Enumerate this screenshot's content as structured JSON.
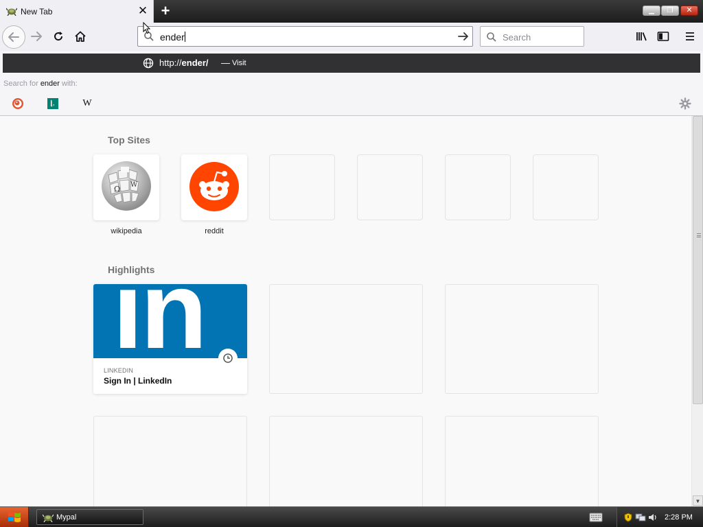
{
  "window": {
    "tab_title": "New Tab",
    "tab_close": "✕",
    "new_tab_symbol": "+",
    "controls": {
      "minimize": "▁",
      "maximize": "❐",
      "close": "✕"
    }
  },
  "toolbar": {
    "url_value": "ender",
    "search_placeholder": "Search"
  },
  "suggestions": {
    "first": {
      "url_prefix": "http://",
      "url_bold": "ender/",
      "dash": "—",
      "action": "Visit"
    },
    "search_with_prefix": "Search for ",
    "search_with_term": "ender",
    "search_with_suffix": " with:",
    "engines": [
      "DuckDuckGo",
      "Bing",
      "Wikipedia"
    ],
    "wiki_glyph": "W"
  },
  "newtab": {
    "top_sites_title": "Top Sites",
    "top_sites": [
      {
        "label": "wikipedia"
      },
      {
        "label": "reddit"
      },
      {
        "label": ""
      },
      {
        "label": ""
      },
      {
        "label": ""
      },
      {
        "label": ""
      }
    ],
    "highlights_title": "Highlights",
    "highlight": {
      "hero_text": "in",
      "source": "LINKEDIN",
      "title": "Sign In | LinkedIn"
    }
  },
  "taskbar": {
    "task_label": "Mypal",
    "time": "2:28 PM"
  },
  "colors": {
    "reddit": "#ff4500",
    "linkedin": "#0274b3",
    "suggestion_bg": "#313133",
    "start_button": "#d9541e"
  }
}
